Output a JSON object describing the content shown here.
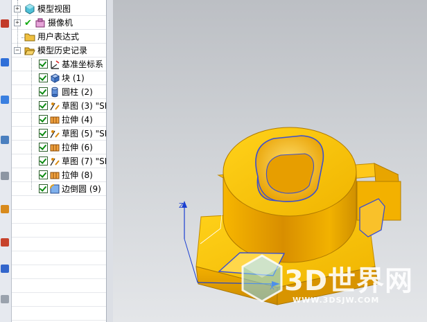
{
  "navigator": {
    "items": [
      {
        "label": "模型视图",
        "icon": "model-views-icon"
      },
      {
        "label": "摄像机",
        "icon": "cameras-icon"
      },
      {
        "label": "用户表达式",
        "icon": "folder-icon"
      },
      {
        "label": "模型历史记录",
        "icon": "open-folder-icon"
      },
      {
        "label": "基准坐标系",
        "icon": "datum-csys-icon"
      },
      {
        "label": "块 (1)",
        "icon": "block-icon"
      },
      {
        "label": "圆柱 (2)",
        "icon": "cylinder-icon"
      },
      {
        "label": "草图 (3) \"SK",
        "icon": "sketch-icon"
      },
      {
        "label": "拉伸 (4)",
        "icon": "extrude-icon"
      },
      {
        "label": "草图 (5) \"SK",
        "icon": "sketch-icon"
      },
      {
        "label": "拉伸 (6)",
        "icon": "extrude-icon"
      },
      {
        "label": "草图 (7) \"SK",
        "icon": "sketch-icon"
      },
      {
        "label": "拉伸 (8)",
        "icon": "extrude-icon"
      },
      {
        "label": "边倒圆 (9)",
        "icon": "edge-blend-icon"
      }
    ]
  },
  "viewport": {
    "triad_z_label": "Z",
    "triad_x_label": "X",
    "model_color": "#f5b800",
    "edge_color": "#3a4fd0"
  },
  "watermark": {
    "text": "3D世界网",
    "url": "WWW.3DSJW.COM"
  }
}
